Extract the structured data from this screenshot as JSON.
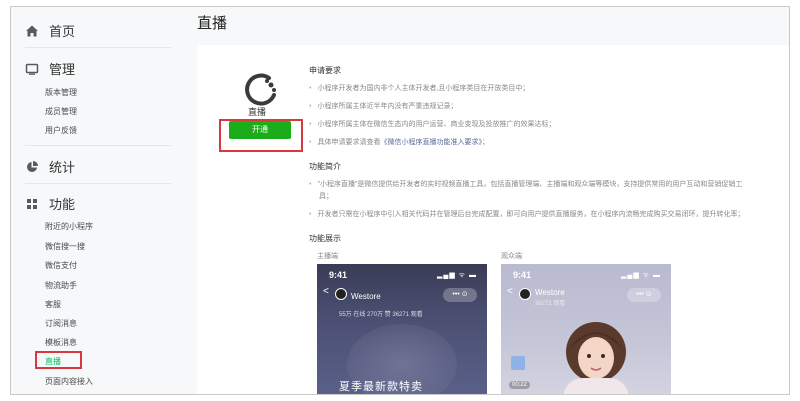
{
  "sidebar": {
    "home": "首页",
    "manage": {
      "label": "管理",
      "items": [
        "版本管理",
        "成员管理",
        "用户反馈"
      ]
    },
    "stats": "统计",
    "features": {
      "label": "功能",
      "items": [
        "附近的小程序",
        "微信搜一搜",
        "微信支付",
        "物流助手",
        "客服",
        "订阅消息",
        "模板消息",
        "直播",
        "页面内容接入"
      ],
      "active_index": 7
    }
  },
  "page": {
    "title": "直播"
  },
  "plugin": {
    "name": "直播",
    "open_label": "开通"
  },
  "requirements": {
    "heading": "申请要求",
    "items": [
      "小程序开发者为国内非个人主体开发者,且小程序类目在开放类目中；",
      "小程序所属主体近半年内没有严重违规记录；",
      "小程序所属主体在微信生态内的用户运营、商业变现及投放推广的效果达标；"
    ],
    "link_prefix": "具体申请要求请查看",
    "link_text": "《微信小程序直播功能准入要求》",
    "link_suffix": "；"
  },
  "intro": {
    "heading": "功能简介",
    "line1": "\"小程序直播\"是微信提供给开发者的实时视频直播工具，包括直播管理端、主播端和观众端等模块，支持提供常用的用户互动和营销促销工",
    "line1b": "具；",
    "line2": "开发者只需在小程序中引入相关代码并在管理后台完成配置，即可向用户提供直播服务，在小程序内流畅完成购买交易闭环，提升转化率；"
  },
  "demo": {
    "heading": "功能展示",
    "host_label": "主播端",
    "viewer_label": "观众端",
    "host": {
      "time": "9:41",
      "status": "▂▄▆ ᯤ ▬",
      "back": "<",
      "name": "Westore",
      "capsule": "••• ⊙",
      "stats": "55万 在线  270万 赞  36271 观看",
      "banner": "夏季最新款特卖"
    },
    "viewer": {
      "time": "9:41",
      "status": "▂▄▆ ᯤ ▬",
      "back": "<",
      "name": "Westore",
      "sub": "36271 观看",
      "capsule": "••• ⊙",
      "gift_count": "00:22"
    }
  },
  "colors": {
    "accent_green": "#1aad19",
    "highlight_red": "#d9383f",
    "link_blue": "#576b95"
  }
}
